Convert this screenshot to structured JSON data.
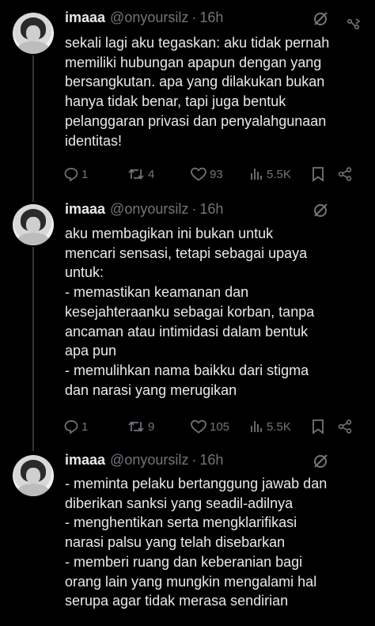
{
  "tweets": [
    {
      "name": "imaaa",
      "handle": "@onyoursilz",
      "separator": "·",
      "time": "16h",
      "lines": [
        "sekali lagi aku tegaskan: aku tidak pernah",
        "memiliki hubungan apapun dengan yang",
        "bersangkutan. apa yang dilakukan bukan",
        "hanya tidak benar, tapi juga bentuk",
        "pelanggaran privasi dan penyalahgunaan",
        "identitas!"
      ],
      "replies": "1",
      "reposts": "4",
      "likes": "93",
      "views": "5.5K"
    },
    {
      "name": "imaaa",
      "handle": "@onyoursilz",
      "separator": "·",
      "time": "16h",
      "lines": [
        "aku membagikan ini bukan untuk",
        "mencari sensasi, tetapi sebagai upaya",
        "untuk:",
        "- memastikan keamanan dan",
        "kesejahteraanku sebagai korban, tanpa",
        "ancaman atau intimidasi dalam bentuk",
        "apa pun",
        "- memulihkan nama baikku dari stigma",
        "dan narasi yang merugikan"
      ],
      "replies": "1",
      "reposts": "9",
      "likes": "105",
      "views": "5.5K"
    },
    {
      "name": "imaaa",
      "handle": "@onyoursilz",
      "separator": "·",
      "time": "16h",
      "lines": [
        "- meminta pelaku bertanggung jawab dan",
        "diberikan sanksi yang seadil-adilnya",
        "- menghentikan serta mengklarifikasi",
        "narasi palsu yang telah disebarkan",
        "- memberi ruang dan keberanian bagi",
        "orang lain yang mungkin mengalami hal",
        "serupa agar tidak merasa sendirian"
      ]
    }
  ],
  "icons": {
    "grok": "grok-icon",
    "more": "more-icon",
    "reply": "reply-icon",
    "repost": "repost-icon",
    "like": "like-icon",
    "views": "views-icon",
    "bookmark": "bookmark-icon",
    "share": "share-icon"
  },
  "colors": {
    "background": "#000000",
    "text": "#e7e9ea",
    "muted": "#71767b",
    "thread_line": "#333639"
  }
}
